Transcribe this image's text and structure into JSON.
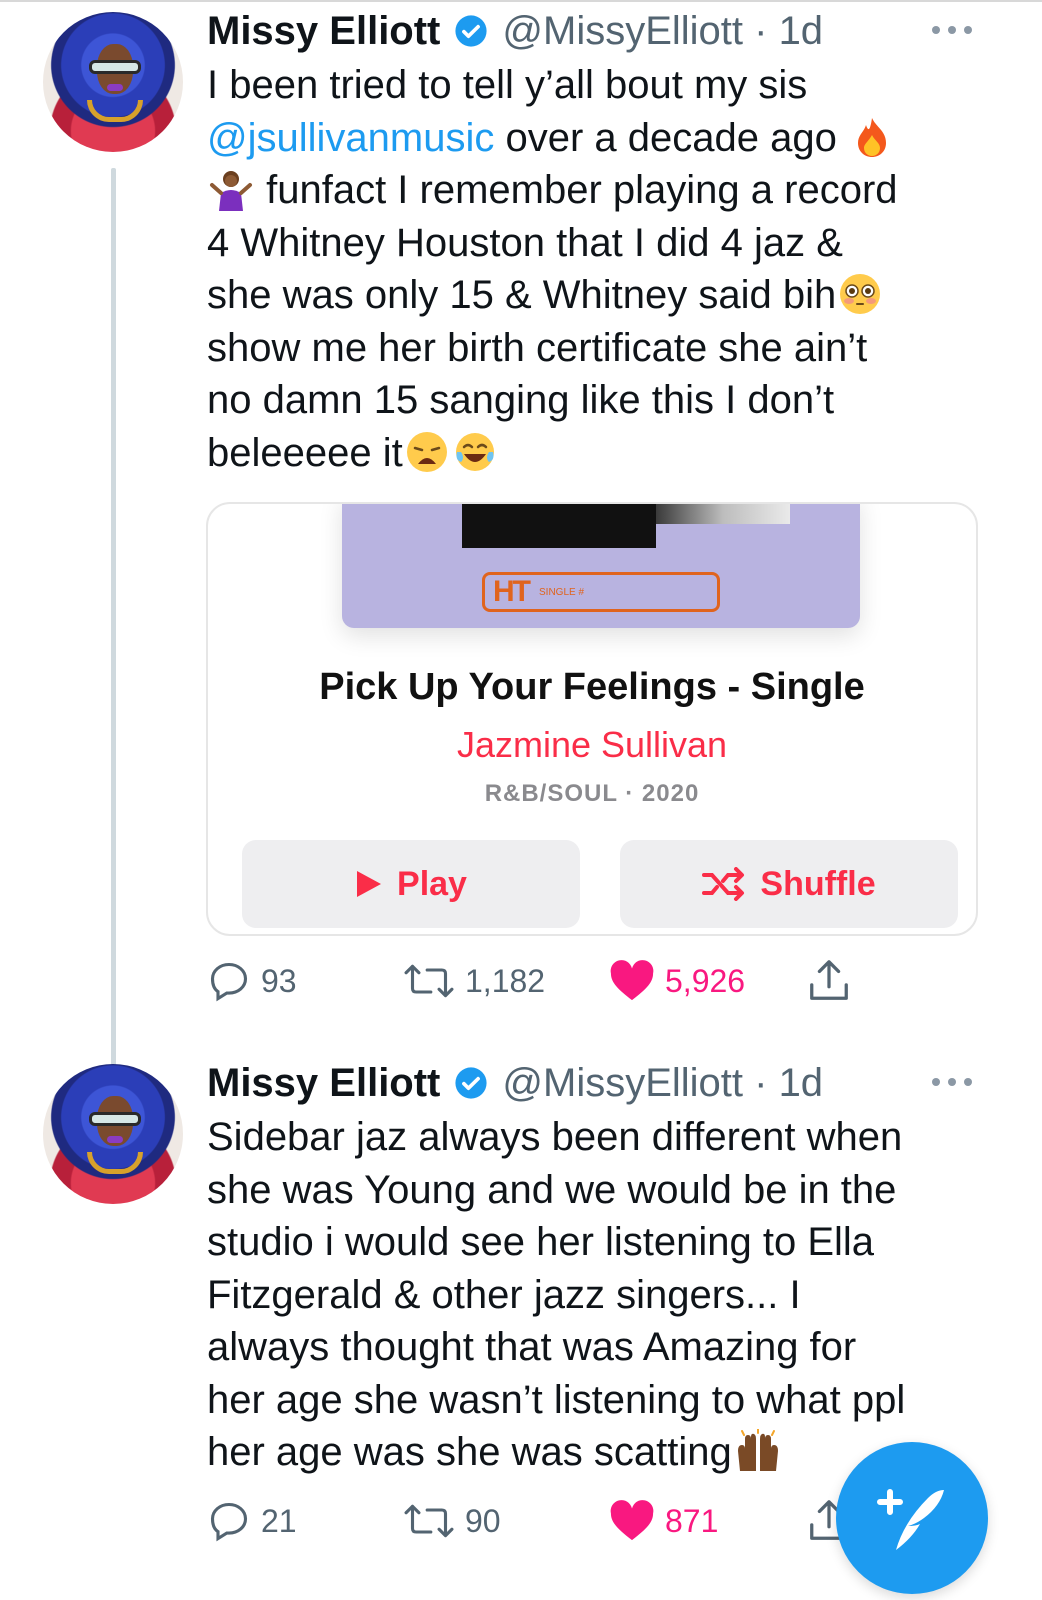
{
  "tweets": [
    {
      "author_name": "Missy Elliott",
      "handle_time": "@MissyElliott · 1d",
      "text_parts": [
        "I been tried to tell y’all bout my sis\n",
        "@jsullivanmusic",
        " over a decade ago ",
        " funfact I remember playing a record\n4 Whitney Houston that I did 4 jaz &\nshe was only 15 & Whitney said bih",
        "\nshow me her birth certificate she ain’t\nno damn 15 sanging like this I don’t\nbeleeeee it"
      ],
      "emoji_names": [
        "fire-emoji",
        "person-shrugging-emoji",
        "flushed-face-emoji",
        "weary-face-emoji",
        "tears-of-joy-emoji"
      ],
      "replies": "93",
      "retweets": "1,182",
      "likes": "5,926"
    },
    {
      "author_name": "Missy Elliott",
      "handle_time": "@MissyElliott · 1d",
      "text": "Sidebar jaz always been different when\nshe was Young and we would be in the\nstudio i would see her listening to Ella\nFitzgerald & other jazz singers... I\nalways thought that was Amazing for\nher age she wasn’t listening to what ppl\nher age was she was scatting",
      "emoji_names": [
        "raising-hands-emoji"
      ],
      "replies": "21",
      "retweets": "90",
      "likes": "871"
    }
  ],
  "music_card": {
    "title": "Pick Up Your Feelings - Single",
    "artist": "Jazmine Sullivan",
    "meta": "R&B/SOUL · 2020",
    "play_label": "Play",
    "shuffle_label": "Shuffle",
    "art_logo": "HT",
    "art_small_text": "SINGLE #",
    "accent_color": "#fa2d48"
  },
  "colors": {
    "twitter_blue": "#1d9bf0",
    "like_pink": "#f91880",
    "muted": "#536471"
  }
}
